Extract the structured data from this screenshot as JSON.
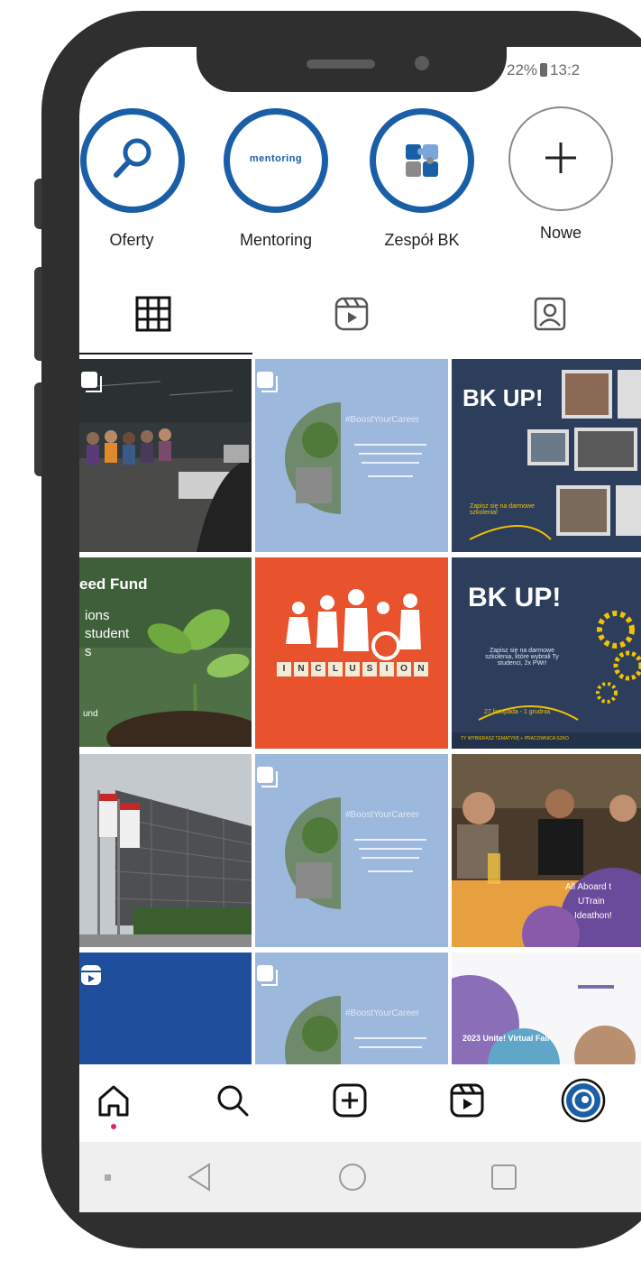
{
  "status_bar": {
    "battery": "22%",
    "time": "13:2"
  },
  "highlights": [
    {
      "label": "Oferty",
      "icon": "magnifier-icon"
    },
    {
      "label": "Mentoring",
      "icon": "mentoring-logo",
      "logo_text": "mentoring"
    },
    {
      "label": "Zespół BK",
      "icon": "puzzle-icon"
    },
    {
      "label": "Nowe",
      "icon": "plus-icon"
    }
  ],
  "profile_tabs": [
    {
      "name": "posts-grid",
      "icon": "grid-icon",
      "active": true
    },
    {
      "name": "reels",
      "icon": "reels-icon",
      "active": false
    },
    {
      "name": "tagged",
      "icon": "tagged-icon",
      "active": false
    }
  ],
  "posts": {
    "seed_fund": {
      "line1": "eed Fund",
      "line2": "ions",
      "line3": "student",
      "line4": "s",
      "line5": "und"
    },
    "inclusion": {
      "letters": [
        "I",
        "N",
        "C",
        "L",
        "U",
        "S",
        "I",
        "O",
        "N"
      ]
    },
    "bkup1": {
      "title": "BK UP!",
      "cta": "Zapisz się na darmowe szkolenia!"
    },
    "bkup2": {
      "title": "BK UP!",
      "line": "Zapisz się na darmowe szkolenia, które wybrali Ty studenci, 2x PWr!",
      "date": "27 listopada - 1 grudnia",
      "footer": "TY WYBIERASZ TEMATYKĘ + PRACOWNICA SZKO"
    },
    "hashtag": "#BoostYourCareer",
    "ideathon": {
      "line1": "All Aboard t",
      "line2": "UTrain",
      "line3": "Ideathon!"
    },
    "virtual_fair": {
      "title": "2023 Unite! Virtual Fair"
    }
  },
  "bottom_nav": [
    {
      "name": "home",
      "icon": "home-icon"
    },
    {
      "name": "search",
      "icon": "search-icon"
    },
    {
      "name": "create",
      "icon": "add-post-icon"
    },
    {
      "name": "reels",
      "icon": "reels-icon"
    },
    {
      "name": "profile",
      "icon": "profile-avatar"
    }
  ],
  "colors": {
    "accent": "#1b5ea8",
    "tile_blue": "#9db8dd",
    "tile_navy": "#2c3e5c",
    "tile_orange": "#e8532d",
    "notification_dot": "#e0245e"
  }
}
